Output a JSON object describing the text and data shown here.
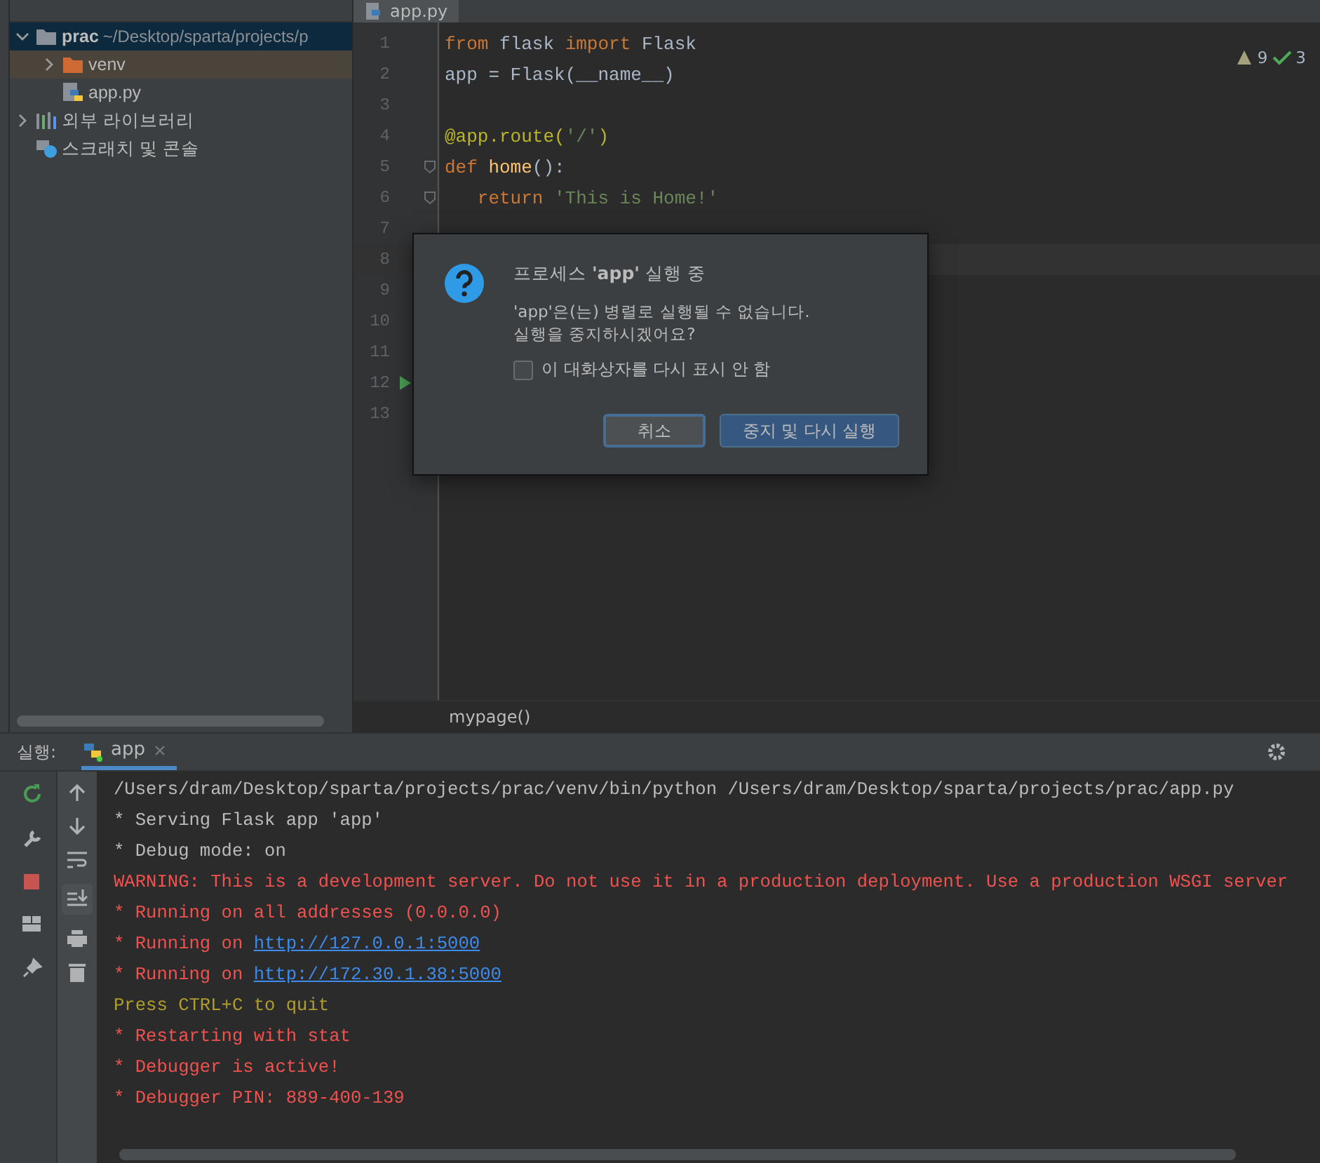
{
  "project_tree": [
    {
      "label": "prac",
      "path": "~/Desktop/sparta/projects/p",
      "kind": "folder",
      "expanded": true,
      "selected": true,
      "children": [
        {
          "label": "venv",
          "kind": "excluded",
          "expanded": false,
          "selected": false
        },
        {
          "label": "app.py",
          "kind": "python",
          "selected": false
        }
      ]
    },
    {
      "label": "외부 라이브러리",
      "kind": "library",
      "expanded": false,
      "selected": false
    },
    {
      "label": "스크래치 및 콘솔",
      "kind": "scratch",
      "selected": false
    }
  ],
  "editor": {
    "tab": "app.py",
    "warnings": "9",
    "weak_warnings": "3",
    "lines": [
      {
        "number": "1",
        "tokens": [
          {
            "text": "from",
            "kind": "keyword"
          },
          {
            "text": "flask",
            "kind": "plain"
          },
          {
            "text": "import",
            "kind": "keyword"
          },
          {
            "text": "Flask",
            "kind": "plain"
          }
        ]
      },
      {
        "number": "2",
        "tokens": [
          {
            "text": "app = Flask(__name__)",
            "kind": "plain"
          }
        ]
      },
      {
        "number": "3"
      },
      {
        "number": "4",
        "tokens": [
          {
            "text": "@app.route(",
            "kind": "decorator"
          },
          {
            "text": "'/'",
            "kind": "string"
          },
          {
            "text": ")",
            "kind": "decorator"
          }
        ]
      },
      {
        "number": "5",
        "fold": true,
        "tokens": [
          {
            "text": "def",
            "kind": "keyword"
          },
          {
            "text": "home",
            "kind": "function"
          },
          {
            "text": "():",
            "kind": "punct"
          }
        ]
      },
      {
        "number": "6",
        "fold": true,
        "indented": true,
        "tokens": [
          {
            "text": "return",
            "kind": "keyword"
          },
          {
            "text": "'This is Home!'",
            "kind": "string"
          }
        ]
      },
      {
        "number": "7"
      },
      {
        "number": "8",
        "current": true
      },
      {
        "number": "9"
      },
      {
        "number": "10"
      },
      {
        "number": "11"
      },
      {
        "number": "12",
        "run": true
      },
      {
        "number": "13"
      }
    ],
    "breadcrumb": "mypage()"
  },
  "dialog": {
    "title": "프로세스 **'app'** 실행 중",
    "message": [
      "'app'은(는) 병렬로 실행될 수 없습니다.",
      "실행을 중지하시겠어요?"
    ],
    "checkbox": {
      "label": "이 대화상자를 다시 표시 안 함",
      "checked": false
    },
    "buttons": [
      {
        "label": "취소",
        "kind": "default"
      },
      {
        "label": "중지 및 다시 실행",
        "kind": "primary"
      }
    ]
  },
  "run_panel": {
    "label": "실행:",
    "tab": "app",
    "console": [
      [
        {
          "text": "/Users/dram/Desktop/sparta/projects/prac/venv/bin/python /Users/dram/Desktop/sparta/projects/prac/app.py",
          "kind": "normal"
        }
      ],
      [
        {
          "text": " * Serving Flask app 'app'",
          "kind": "normal"
        }
      ],
      [
        {
          "text": " * Debug mode: on",
          "kind": "normal"
        }
      ],
      [
        {
          "text": "WARNING: This is a development server. Do not use it in a production deployment. Use a production WSGI server",
          "kind": "error"
        }
      ],
      [
        {
          "text": " * Running on all addresses (0.0.0.0)",
          "kind": "error"
        }
      ],
      [
        {
          "text": " * Running on",
          "kind": "error"
        },
        {
          "text": "http://127.0.0.1:5000",
          "kind": "link"
        }
      ],
      [
        {
          "text": " * Running on",
          "kind": "error"
        },
        {
          "text": "http://172.30.1.38:5000",
          "kind": "link"
        }
      ],
      [
        {
          "text": "Press CTRL+C to quit",
          "kind": "warn"
        }
      ],
      [
        {
          "text": " * Restarting with stat",
          "kind": "error"
        }
      ],
      [
        {
          "text": " * Debugger is active!",
          "kind": "error"
        }
      ],
      [
        {
          "text": " * Debugger PIN: 889-400-139",
          "kind": "error"
        }
      ]
    ]
  }
}
